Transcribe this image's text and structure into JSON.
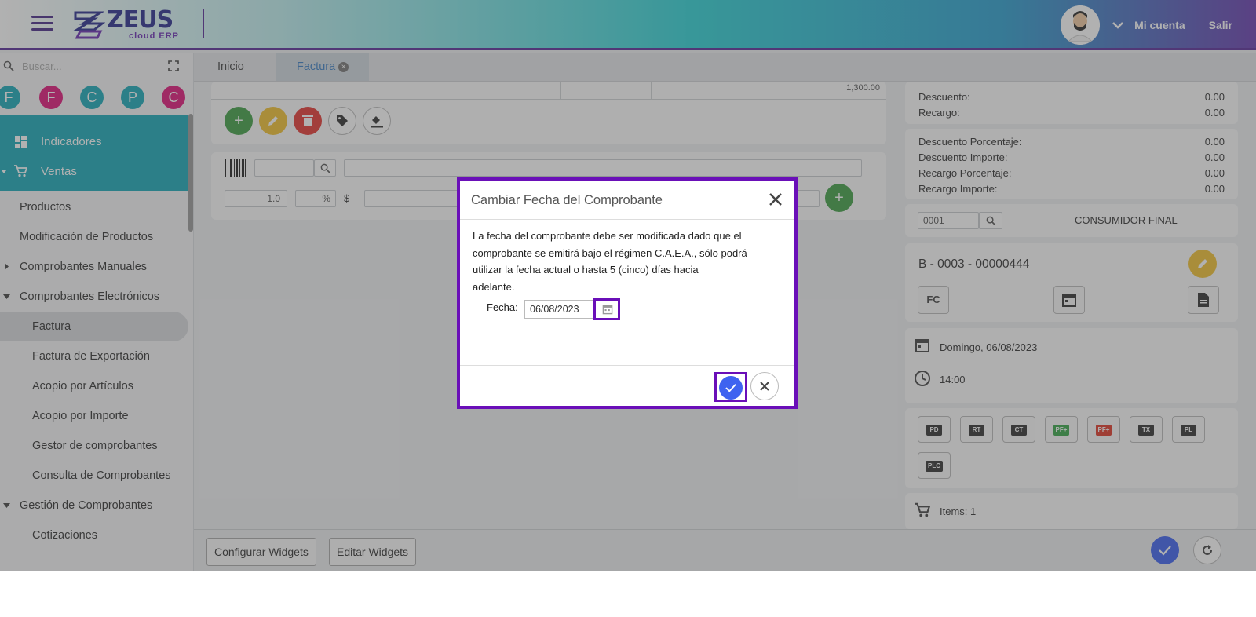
{
  "header": {
    "brand": "ZEUS",
    "brand_sub": "cloud ERP",
    "account_label": "Mi cuenta",
    "logout_label": "Salir"
  },
  "sidebar": {
    "search_placeholder": "Buscar...",
    "shortcuts": [
      {
        "letter": "F",
        "color": "#1aaab8"
      },
      {
        "letter": "F",
        "color": "#e0187a"
      },
      {
        "letter": "C",
        "color": "#1aaab8"
      },
      {
        "letter": "P",
        "color": "#1aaab8"
      },
      {
        "letter": "C",
        "color": "#e0187a"
      }
    ],
    "highlight_items": [
      {
        "label": "Indicadores",
        "icon": "dashboard-icon"
      },
      {
        "label": "Ventas",
        "icon": "cart-icon"
      }
    ],
    "items": [
      {
        "label": "Productos"
      },
      {
        "label": "Modificación de Productos"
      },
      {
        "label": "Comprobantes Manuales"
      },
      {
        "label": "Comprobantes Electrónicos"
      },
      {
        "label": "Factura"
      },
      {
        "label": "Factura de Exportación"
      },
      {
        "label": "Acopio por Artículos"
      },
      {
        "label": "Acopio por Importe"
      },
      {
        "label": "Gestor de comprobantes"
      },
      {
        "label": "Consulta de Comprobantes"
      },
      {
        "label": "Gestión de Comprobantes"
      },
      {
        "label": "Cotizaciones"
      }
    ]
  },
  "tabs": [
    {
      "label": "Inicio"
    },
    {
      "label": "Factura"
    }
  ],
  "invoice": {
    "line_amount": "1,300.00",
    "quantity": "1.0",
    "percent_symbol": "%",
    "currency_symbol": "$"
  },
  "summary": {
    "descuento_label": "Descuento:",
    "descuento_value": "0.00",
    "recargo_label": "Recargo:",
    "recargo_value": "0.00",
    "desc_pct_label": "Descuento Porcentaje:",
    "desc_pct_value": "0.00",
    "desc_imp_label": "Descuento Importe:",
    "desc_imp_value": "0.00",
    "rec_pct_label": "Recargo Porcentaje:",
    "rec_pct_value": "0.00",
    "rec_imp_label": "Recargo Importe:",
    "rec_imp_value": "0.00"
  },
  "client": {
    "code": "0001",
    "name": "CONSUMIDOR FINAL"
  },
  "voucher": {
    "number": "B - 0003 - 00000444",
    "type": "FC",
    "date": "Domingo, 06/08/2023",
    "time": "14:00",
    "items": "Items: 1"
  },
  "doc_buttons": [
    {
      "code": "PD",
      "color": "#333"
    },
    {
      "code": "RT",
      "color": "#333"
    },
    {
      "code": "CT",
      "color": "#333"
    },
    {
      "code": "PF+",
      "color": "#3aa84a"
    },
    {
      "code": "PF+",
      "color": "#e03a2a"
    },
    {
      "code": "TX",
      "color": "#333"
    },
    {
      "code": "PL",
      "color": "#333"
    },
    {
      "code": "PLC",
      "color": "#333"
    }
  ],
  "footer": {
    "configure_label": "Configurar Widgets",
    "edit_label": "Editar Widgets"
  },
  "modal": {
    "title": "Cambiar Fecha del Comprobante",
    "body_lines": [
      "La fecha del comprobante debe ser modificada dado que el",
      "comprobante se emitirá bajo el régimen C.A.E.A., sólo podrá",
      "utilizar la fecha actual o hasta 5 (cinco) días hacia",
      "adelante."
    ],
    "date_label": "Fecha:",
    "date_value": "06/08/2023",
    "accent": "#6a0fb8",
    "confirm_color": "#3f63f0"
  }
}
